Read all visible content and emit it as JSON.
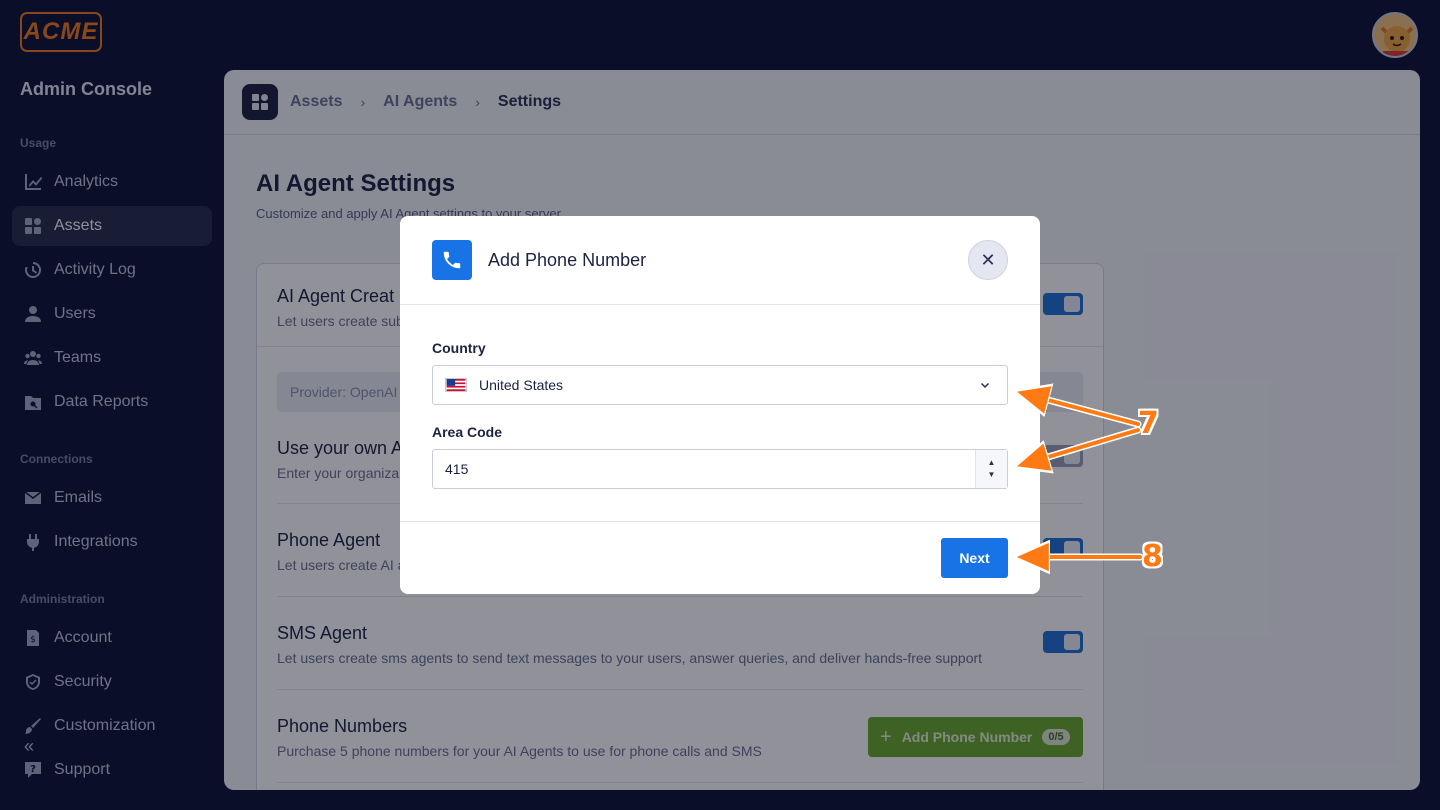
{
  "brand": {
    "logo_text": "ACME"
  },
  "sidebar": {
    "title": "Admin Console",
    "sections": [
      {
        "label": "Usage",
        "items": [
          {
            "label": "Analytics",
            "icon": "chart-line-icon"
          },
          {
            "label": "Assets",
            "icon": "grid-icon",
            "active": true
          },
          {
            "label": "Activity Log",
            "icon": "history-icon"
          },
          {
            "label": "Users",
            "icon": "user-icon"
          },
          {
            "label": "Teams",
            "icon": "team-icon"
          },
          {
            "label": "Data Reports",
            "icon": "folder-search-icon"
          }
        ]
      },
      {
        "label": "Connections",
        "items": [
          {
            "label": "Emails",
            "icon": "envelope-icon"
          },
          {
            "label": "Integrations",
            "icon": "plug-icon"
          }
        ]
      },
      {
        "label": "Administration",
        "items": [
          {
            "label": "Account",
            "icon": "receipt-icon"
          },
          {
            "label": "Security",
            "icon": "shield-icon"
          },
          {
            "label": "Customization",
            "icon": "brush-icon"
          },
          {
            "label": "Support",
            "icon": "chat-question-icon"
          }
        ]
      }
    ],
    "collapse_glyph": "«"
  },
  "breadcrumb": {
    "items": [
      "Assets",
      "AI Agents",
      "Settings"
    ],
    "separator": "›"
  },
  "page": {
    "title": "AI Agent Settings",
    "subtitle": "Customize and apply AI Agent settings to your server"
  },
  "settings": {
    "creation": {
      "title": "AI Agent Creat",
      "desc": "Let users create sub",
      "enabled": true
    },
    "provider": {
      "text": "Provider: OpenAI"
    },
    "own_key": {
      "title": "Use your own A",
      "desc": "Enter your organiza",
      "enabled": false
    },
    "phone_agent": {
      "title": "Phone Agent",
      "desc": "Let users create AI a",
      "enabled": true
    },
    "sms_agent": {
      "title": "SMS Agent",
      "desc": "Let users create sms agents to send text messages to your users, answer queries, and deliver hands-free support",
      "enabled": true
    },
    "phone_numbers": {
      "title": "Phone Numbers",
      "desc": "Purchase 5 phone numbers for your AI Agents to use for phone calls and SMS",
      "button_label": "Add Phone Number",
      "badge": "0/5"
    }
  },
  "modal": {
    "title": "Add Phone Number",
    "close_glyph": "✕",
    "country_label": "Country",
    "country_value": "United States",
    "area_code_label": "Area Code",
    "area_code_value": "415",
    "next_label": "Next"
  },
  "annotations": {
    "step_a": "7",
    "step_b": "8",
    "color": "#ff7a12"
  }
}
